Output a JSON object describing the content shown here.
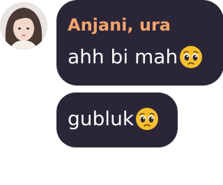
{
  "chat": {
    "avatar_icon": "profile-photo",
    "messages": [
      {
        "sender": "Anjani, ura",
        "text": "ahh bi mah",
        "emoji": "pleading-face-emoji"
      },
      {
        "text": "gubluk",
        "emoji": "pleading-face-emoji"
      }
    ]
  },
  "colors": {
    "bubble_bg": "#2b2538",
    "sender_name": "#f2a46c",
    "message_text": "#ffffff",
    "emoji_face": "#f7c02c"
  }
}
